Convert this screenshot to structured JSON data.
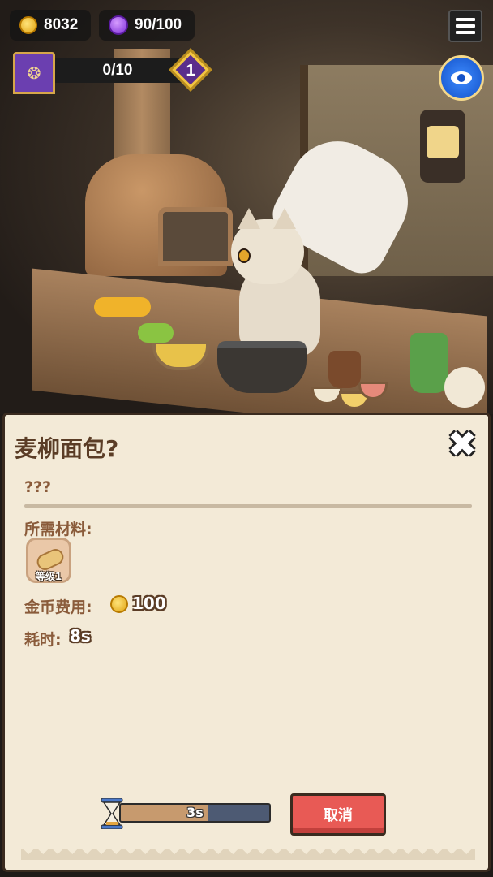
{
  "hud": {
    "coins": "8032",
    "energy": "90/100",
    "progress": "0/10",
    "level": "1"
  },
  "icons": {
    "coin": "coin-icon",
    "energy": "purple-gem-icon",
    "menu": "hamburger-menu-icon",
    "banner": "guild-banner-icon",
    "vision": "eye-icon",
    "close": "close-x-icon",
    "hourglass": "hourglass-icon",
    "material": "bread-loaf-icon"
  },
  "panel": {
    "title": "麦柳面包?",
    "description": "???",
    "materials_label": "所需材料:",
    "material_level": "等级1",
    "cost_label": "金币费用:",
    "cost_value": "100",
    "time_label": "耗时:",
    "time_value": "8s",
    "timer_text": "3s",
    "timer_progress": 0.59,
    "cancel_label": "取消"
  },
  "colors": {
    "panel_bg": "#f3ead7",
    "text_brown": "#8a5b3a",
    "cancel_red": "#e85a55",
    "timer_fill": "#c79a6e",
    "timer_track": "#4d5a73"
  }
}
